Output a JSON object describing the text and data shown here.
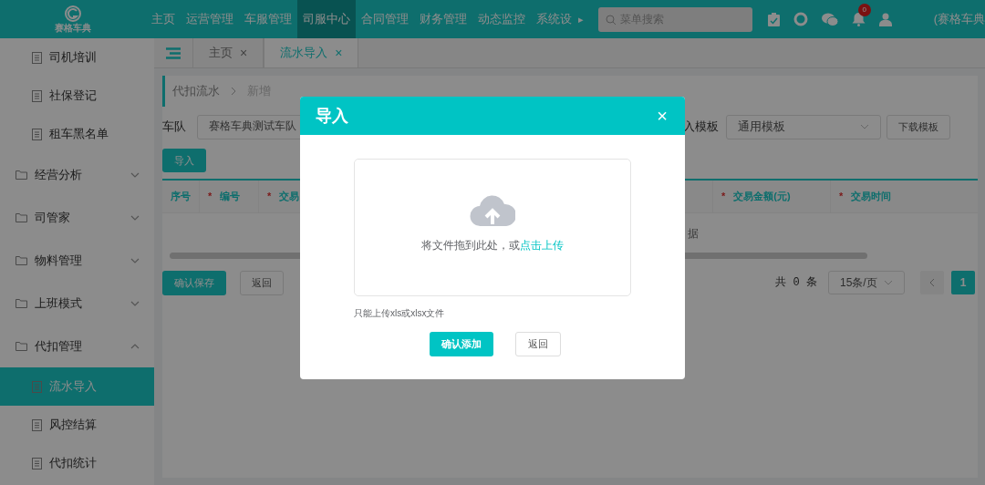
{
  "header": {
    "logo_text": "赛格车典",
    "nav": [
      {
        "label": "主页",
        "selected": false
      },
      {
        "label": "运营管理",
        "selected": false
      },
      {
        "label": "车服管理",
        "selected": false
      },
      {
        "label": "司服中心",
        "selected": true
      },
      {
        "label": "合同管理",
        "selected": false
      },
      {
        "label": "财务管理",
        "selected": false
      },
      {
        "label": "动态监控",
        "selected": false
      },
      {
        "label": "系统设",
        "selected": false
      }
    ],
    "nav_more": "▸",
    "search": {
      "placeholder": "菜单搜索"
    },
    "notification_count": "0",
    "user_org": "(赛格车典"
  },
  "sidebar": {
    "items": [
      {
        "label": "司机培训",
        "kind": "page",
        "selected": false
      },
      {
        "label": "社保登记",
        "kind": "page",
        "selected": false
      },
      {
        "label": "租车黑名单",
        "kind": "page",
        "selected": false
      },
      {
        "label": "经营分析",
        "kind": "folder",
        "expanded": false,
        "selected": false
      },
      {
        "label": "司管家",
        "kind": "folder",
        "expanded": false,
        "selected": false
      },
      {
        "label": "物料管理",
        "kind": "folder",
        "expanded": false,
        "selected": false
      },
      {
        "label": "上班模式",
        "kind": "folder",
        "expanded": false,
        "selected": false
      },
      {
        "label": "代扣管理",
        "kind": "folder",
        "expanded": true,
        "selected": false
      },
      {
        "label": "流水导入",
        "kind": "page",
        "selected": true
      },
      {
        "label": "风控结算",
        "kind": "page",
        "selected": false
      },
      {
        "label": "代扣统计",
        "kind": "page",
        "selected": false
      }
    ]
  },
  "tabs": [
    {
      "label": "主页",
      "selected": false,
      "close": "×"
    },
    {
      "label": "流水导入",
      "selected": true,
      "close": "×"
    }
  ],
  "breadcrumb": [
    "代扣流水",
    "新增"
  ],
  "filters": {
    "fleet_label": "车队",
    "fleet_value": "赛格车典测试车队",
    "template_label": "入模板",
    "template_value": "通用模板",
    "download_button": "下载模板"
  },
  "import_button": "导入",
  "table": {
    "required_symbol": "*",
    "columns": [
      {
        "label": "序号",
        "required": false
      },
      {
        "label": "编号",
        "required": true
      },
      {
        "label": "交易",
        "required": true
      },
      {
        "label": "交易金额(元)",
        "required": true
      },
      {
        "label": "交易时间",
        "required": true
      }
    ],
    "empty_text": "据"
  },
  "actions": [
    "确认保存",
    "返回"
  ],
  "pagination": {
    "total": "共 0 条",
    "page_size": "15条/页",
    "pages": [
      {
        "label": "1",
        "selected": true
      }
    ]
  },
  "dialog": {
    "title": "导入",
    "close": "×",
    "drop_text": "将文件拖到此处，或",
    "drop_link": "点击上传",
    "hint": "只能上传xls或xlsx文件",
    "confirm": "确认添加",
    "back": "返回"
  }
}
